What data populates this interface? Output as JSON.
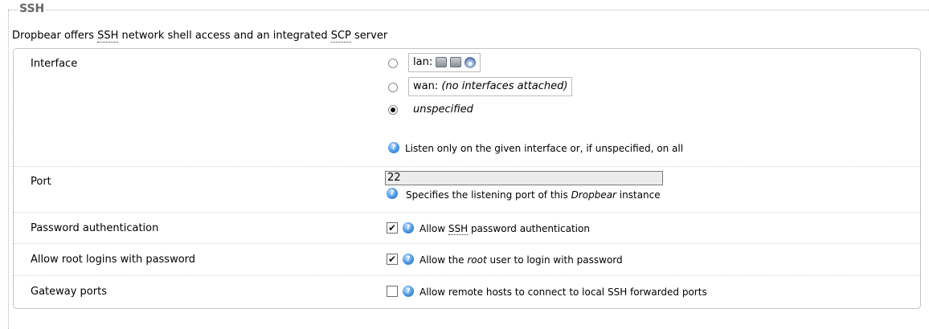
{
  "section": {
    "title": "SSH",
    "description_pre": "Dropbear offers ",
    "description_abbr1": "SSH",
    "description_mid": " network shell access and an integrated ",
    "description_abbr2": "SCP",
    "description_post": " server"
  },
  "interface": {
    "label": "Interface",
    "options": [
      {
        "name": "lan:",
        "detail": "",
        "selected": false
      },
      {
        "name": "wan:",
        "detail": "(no interfaces attached)",
        "selected": false
      },
      {
        "name": "unspecified",
        "detail": "",
        "selected": true
      }
    ],
    "hint": "Listen only on the given interface or, if unspecified, on all"
  },
  "port": {
    "label": "Port",
    "value": "22",
    "hint_pre": "Specifies the listening port of this ",
    "hint_em": "Dropbear",
    "hint_post": " instance"
  },
  "password_auth": {
    "label": "Password authentication",
    "checked": true,
    "hint_pre": "Allow ",
    "hint_abbr": "SSH",
    "hint_post": " password authentication"
  },
  "root_login": {
    "label": "Allow root logins with password",
    "checked": true,
    "hint_pre": "Allow the ",
    "hint_em": "root",
    "hint_post": " user to login with password"
  },
  "gateway_ports": {
    "label": "Gateway ports",
    "checked": false,
    "hint": "Allow remote hosts to connect to local SSH forwarded ports"
  },
  "icons": {
    "help": "help-icon",
    "ethernet": "ethernet-icon",
    "wireless": "wireless-icon",
    "check": "✔"
  }
}
